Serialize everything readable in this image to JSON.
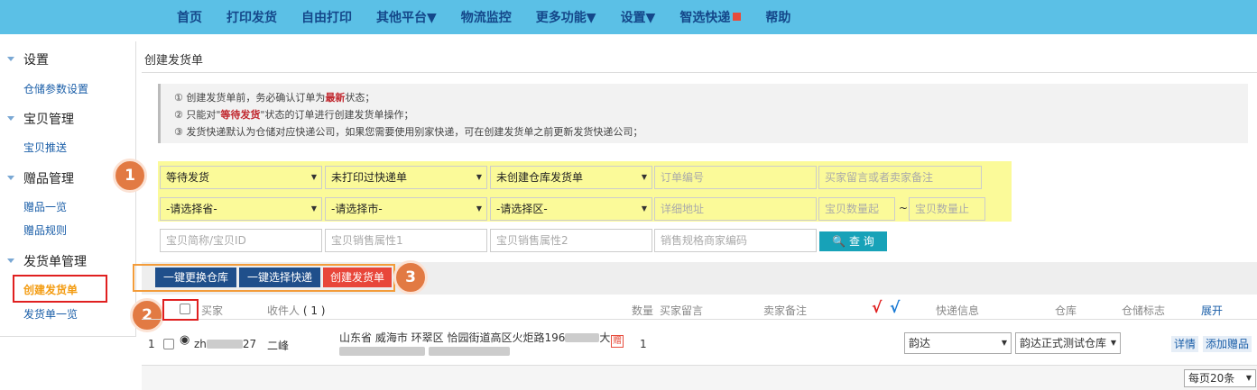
{
  "nav": [
    "首页",
    "打印发货",
    "自由打印",
    "其他平台▼",
    "物流监控",
    "更多功能▼",
    "设置▼",
    "智选快递",
    "帮助"
  ],
  "sidebar": {
    "groups": [
      {
        "title": "设置",
        "items": [
          "仓储参数设置"
        ]
      },
      {
        "title": "宝贝管理",
        "items": [
          "宝贝推送"
        ]
      },
      {
        "title": "赠品管理",
        "items": [
          "赠品一览",
          "赠品规则"
        ]
      },
      {
        "title": "发货单管理",
        "items": [
          "创建发货单",
          "发货单一览"
        ]
      }
    ]
  },
  "page_title": "创建发货单",
  "notice": {
    "line1_a": "① 创建发货单前，务必确认订单为",
    "line1_b": "最新",
    "line1_c": "状态；",
    "line2_a": "② 只能对\"",
    "line2_b": "等待发货",
    "line2_c": "\"状态的订单进行创建发货单操作；",
    "line3": "③ 发货快递默认为仓储对应快递公司，如果您需要使用别家快递，可在创建发货单之前更新发货快递公司；"
  },
  "filters": {
    "status": "等待发货",
    "print_status": "未打印过快递单",
    "warehouse_status": "未创建仓库发货单",
    "order_no_ph": "订单编号",
    "remark_ph": "买家留言或者卖家备注",
    "province": "-请选择省-",
    "city": "-请选择市-",
    "district": "-请选择区-",
    "address_ph": "详细地址",
    "qty_from_ph": "宝贝数量起",
    "tilde": "~",
    "qty_to_ph": "宝贝数量止",
    "item_id_ph": "宝贝简称/宝贝ID",
    "attr1_ph": "宝贝销售属性1",
    "attr2_ph": "宝贝销售属性2",
    "sku_ph": "销售规格商家编码",
    "query": "查 询"
  },
  "actions": [
    "一键更换仓库",
    "一键选择快递",
    "创建发货单"
  ],
  "badges": [
    "1",
    "2",
    "3"
  ],
  "table": {
    "headers": {
      "buyer": "买家",
      "receiver": "收件人",
      "receiver_count": "( 1 )",
      "qty": "数量",
      "buyer_msg": "买家留言",
      "seller_note": "卖家备注",
      "red_check": "√",
      "blue_check": "√",
      "express": "快递信息",
      "warehouse": "仓库",
      "wh_flag": "仓储标志",
      "expand": "展开"
    },
    "row": {
      "index": "1",
      "buyer_a": "zh",
      "buyer_b": "27",
      "receiver": "二峰",
      "address": "山东省 威海市 环翠区 恰园街道高区火炬路196",
      "address_end": "大",
      "gift_badge": "赠",
      "qty": "1",
      "express": "韵达",
      "warehouse": "韵达正式测试仓库",
      "detail": "详情",
      "add_gift": "添加赠品"
    }
  },
  "per_page": "每页20条"
}
